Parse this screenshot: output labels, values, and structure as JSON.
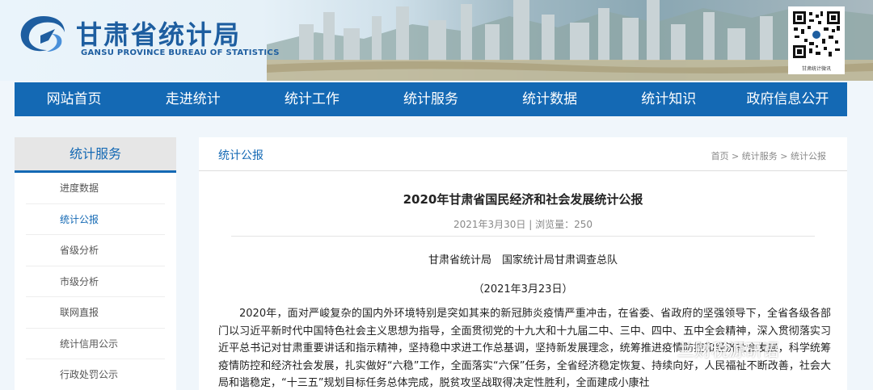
{
  "header": {
    "logo_cn": "甘肃省统计局",
    "logo_en": "GANSU PROVINCE BUREAU OF STATISTICS",
    "qr_caption": "甘肃统计微讯"
  },
  "nav": {
    "items": [
      "网站首页",
      "走进统计",
      "统计工作",
      "统计服务",
      "统计数据",
      "统计知识",
      "政府信息公开"
    ]
  },
  "sidebar": {
    "title": "统计服务",
    "items": [
      {
        "label": "进度数据"
      },
      {
        "label": "统计公报"
      },
      {
        "label": "省级分析"
      },
      {
        "label": "市级分析"
      },
      {
        "label": "联网直报"
      },
      {
        "label": "统计信用公示"
      },
      {
        "label": "行政处罚公示"
      }
    ]
  },
  "main": {
    "section_title": "统计公报",
    "breadcrumb": [
      "首页",
      "统计服务",
      "统计公报"
    ],
    "breadcrumb_sep": " > ",
    "article_title": "2020年甘肃省国民经济和社会发展统计公报",
    "meta": "2021年3月30日 | 浏览量：250",
    "org": "甘肃省统计局　国家统计局甘肃调查总队",
    "date": "（2021年3月23日）",
    "body": "2020年，面对严峻复杂的国内外环境特别是突如其来的新冠肺炎疫情严重冲击，在省委、省政府的坚强领导下，全省各级各部门以习近平新时代中国特色社会主义思想为指导，全面贯彻党的十九大和十九届二中、三中、四中、五中全会精神，深入贯彻落实习近平总书记对甘肃重要讲话和指示精神，坚持稳中求进工作总基调，坚持新发展理念，统筹推进疫情防控和经济社会发展，科学统筹疫情防控和经济社会发展，扎实做好“六稳”工作，全面落实“六保”任务，全省经济稳定恢复、持续向好，人民福祉不断改善，社会大局和谐稳定，“十三五”规划目标任务总体完成，脱贫攻坚战取得决定性胜利，全面建成小康社"
  },
  "watermark": "兰财税源研语"
}
